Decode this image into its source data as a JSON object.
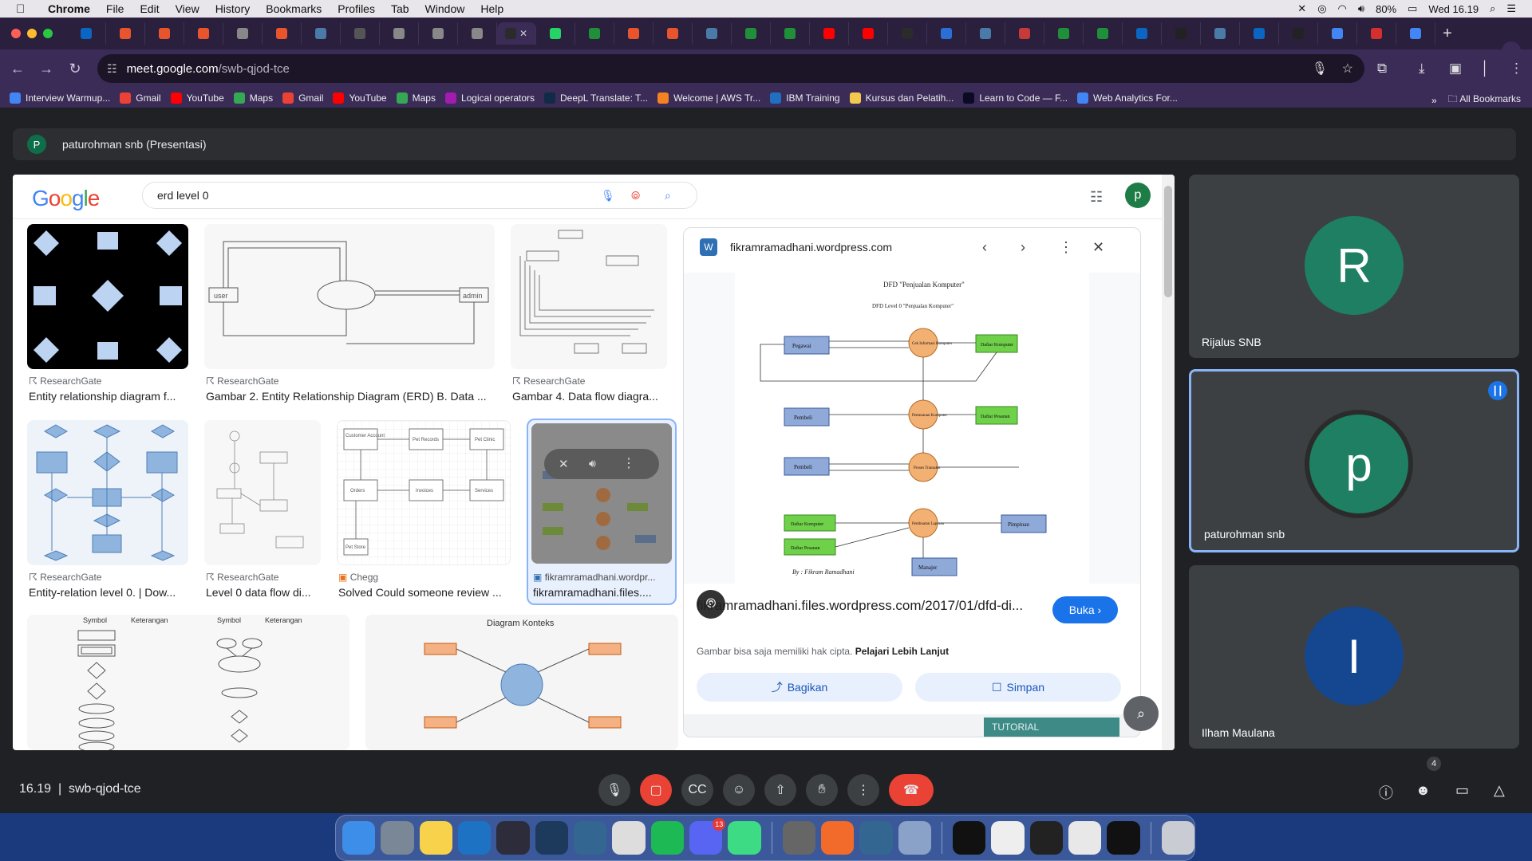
{
  "menubar": {
    "app": "Chrome",
    "items": [
      "File",
      "Edit",
      "View",
      "History",
      "Bookmarks",
      "Profiles",
      "Tab",
      "Window",
      "Help"
    ],
    "battery": "80%",
    "clock": "Wed 16.19"
  },
  "tabs": {
    "favicon_colors": [
      "#0a66c2",
      "#e8552d",
      "#e8552d",
      "#e8552d",
      "#888",
      "#e8552d",
      "#4a7aa7",
      "#555",
      "#888",
      "#888",
      "#888",
      "#2b2b2b",
      "#25d366",
      "#1f8f3a",
      "#e8552d",
      "#e8552d",
      "#4a7aa7",
      "#1f8f3a",
      "#1f8f3a",
      "#ff0000",
      "#ff0000",
      "#2b2b2b",
      "#2b6fd6",
      "#4a7aa7",
      "#c73a3a",
      "#1f8f3a",
      "#1f8f3a",
      "#0a66c2",
      "#222",
      "#4a7aa7",
      "#0a66c2",
      "#222",
      "#4285f4",
      "#d32f2f",
      "#4285f4"
    ],
    "active_index": 11
  },
  "address": {
    "domain": "meet.google.com",
    "path": "/swb-qjod-tce"
  },
  "bookmarks": [
    {
      "label": "Interview Warmup...",
      "color": "#4285f4"
    },
    {
      "label": "Gmail",
      "color": "#ea4335"
    },
    {
      "label": "YouTube",
      "color": "#ff0000"
    },
    {
      "label": "Maps",
      "color": "#34a853"
    },
    {
      "label": "Gmail",
      "color": "#ea4335"
    },
    {
      "label": "YouTube",
      "color": "#ff0000"
    },
    {
      "label": "Maps",
      "color": "#34a853"
    },
    {
      "label": "Logical operators",
      "color": "#a21caf"
    },
    {
      "label": "DeepL Translate: T...",
      "color": "#0f2b46"
    },
    {
      "label": "Welcome | AWS Tr...",
      "color": "#f58220"
    },
    {
      "label": "IBM Training",
      "color": "#1f70c1"
    },
    {
      "label": "Kursus dan Pelatih...",
      "color": "#f2c94c"
    },
    {
      "label": "Learn to Code — F...",
      "color": "#0a0a23"
    },
    {
      "label": "Web Analytics For...",
      "color": "#4285f4"
    }
  ],
  "all_bookmarks": "All Bookmarks",
  "meet": {
    "presenter": "paturohman snb (Presentasi)",
    "presenter_initial": "P",
    "meeting_time": "16.19",
    "meeting_code": "swb-qjod-tce",
    "people_count": "4"
  },
  "google": {
    "logo": "Google",
    "query": "erd level 0",
    "avatar": "p"
  },
  "results": [
    {
      "source": "ResearchGate",
      "title": "Entity relationship diagram f..."
    },
    {
      "source": "ResearchGate",
      "title": "Gambar 2. Entity Relationship Diagram (ERD) B. Data ..."
    },
    {
      "source": "ResearchGate",
      "title": "Gambar 4. Data flow diagra..."
    },
    {
      "source": "ResearchGate",
      "title": "Entity-relation level 0. | Dow..."
    },
    {
      "source": "ResearchGate",
      "title": "Level 0 data flow di..."
    },
    {
      "source": "Chegg",
      "title": "Solved Could someone review ..."
    },
    {
      "source": "fikramramadhani.wordpr...",
      "title": "fikramramadhani.files...."
    }
  ],
  "thumb_texts": {
    "erd_user": "user",
    "erd_admin": "admin",
    "vet_labels": [
      "Customer Account",
      "Pet Records",
      "Pet Clinic",
      "Orders",
      "Invoices",
      "Services",
      "Pet Store"
    ],
    "konteks_title": "Diagram Konteks",
    "symbol_headers": [
      "Symbol",
      "Keterangan",
      "Symbol",
      "Keterangan"
    ]
  },
  "preview": {
    "site": "fikramramadhani.wordpress.com",
    "title": "fikramramadhani.files.wordpress.com/2017/01/dfd-di...",
    "open_button": "Buka",
    "note": "Gambar bisa saja memiliki hak cipta.",
    "note_link": "Pelajari Lebih Lanjut",
    "share": "Bagikan",
    "save": "Simpan",
    "tutorial": "TUTORIAL",
    "dfd_title": "DFD \"Penjualan Komputer\"",
    "dfd_sub": "DFD Level 0 \"Penjualan Komputer\"",
    "dfd_sign": "By : Fikram Ramadhani",
    "dfd_entities": [
      "Pegawai",
      "Pembeli",
      "Pembeli",
      "Pimpinan",
      "Manajer"
    ],
    "dfd_stores": [
      "Daftar Komputer",
      "Daftar Pesanan",
      "Daftar Komputer",
      "Daftar Pesanan"
    ],
    "dfd_processes": [
      "Cek Informasi Komputer",
      "Pemesanan Komputer",
      "Proses Transaksi",
      "Pembuatan Laporan"
    ]
  },
  "participants": [
    {
      "name": "Rijalus SNB",
      "initial": "R",
      "color": "#1f7f62"
    },
    {
      "name": "paturohman snb",
      "initial": "p",
      "color": "#1f7f62",
      "speaking": true
    },
    {
      "name": "Ilham Maulana",
      "initial": "I",
      "color": "#14478f"
    }
  ],
  "dock": {
    "apps": [
      {
        "name": "finder",
        "color": "#3d8ee8"
      },
      {
        "name": "launchpad",
        "color": "#7a8797"
      },
      {
        "name": "notes",
        "color": "#f7d24a"
      },
      {
        "name": "vscode",
        "color": "#1e72c4"
      },
      {
        "name": "telegram-like",
        "color": "#2c2c3a"
      },
      {
        "name": "mysql-workbench",
        "color": "#1d3a5c"
      },
      {
        "name": "postgres",
        "color": "#336791"
      },
      {
        "name": "chrome",
        "color": "#dddddd"
      },
      {
        "name": "spotify",
        "color": "#1db954"
      },
      {
        "name": "discord",
        "color": "#5865f2"
      },
      {
        "name": "android-studio",
        "color": "#3ddc84"
      },
      {
        "name": "system-settings",
        "color": "#666"
      },
      {
        "name": "sketch-pen",
        "color": "#f26b2a"
      },
      {
        "name": "postgres-2",
        "color": "#336791"
      },
      {
        "name": "preview",
        "color": "#8aa2c8"
      },
      {
        "name": "window-1",
        "color": "#111"
      },
      {
        "name": "window-2",
        "color": "#eee"
      },
      {
        "name": "window-3",
        "color": "#222"
      },
      {
        "name": "window-4",
        "color": "#e8e8e8"
      },
      {
        "name": "window-5",
        "color": "#111"
      },
      {
        "name": "trash",
        "color": "#c9cdd3"
      }
    ],
    "discord_badge": "13"
  }
}
